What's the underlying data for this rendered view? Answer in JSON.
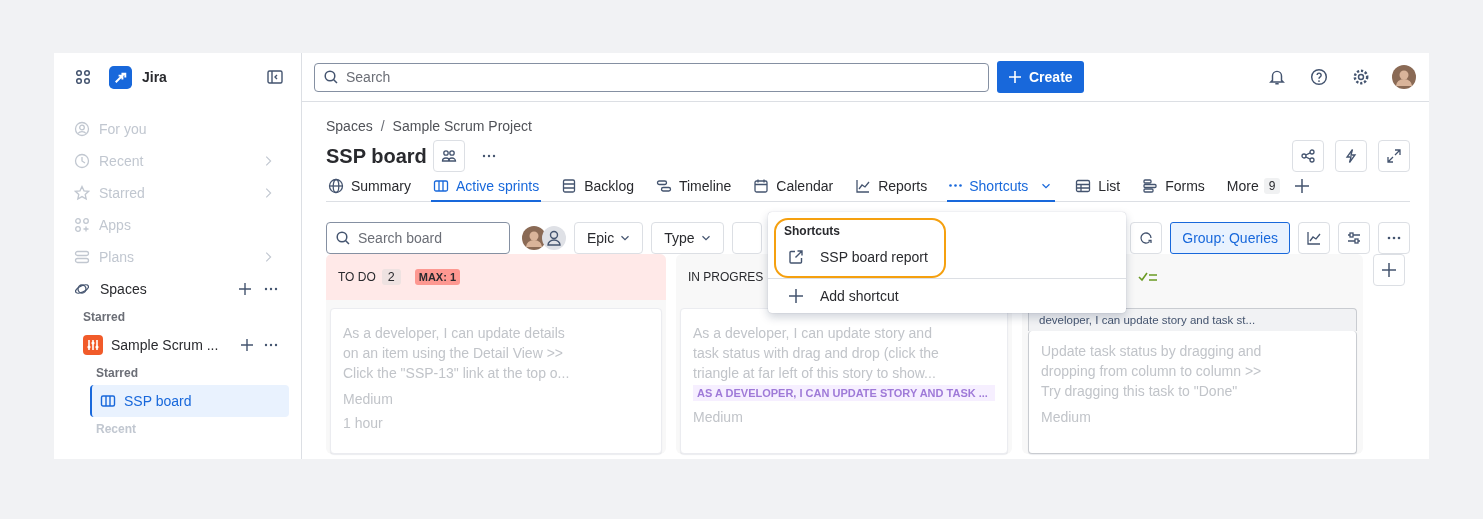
{
  "app": {
    "name": "Jira"
  },
  "sidebar": {
    "nav": [
      {
        "label": "For you",
        "disabled": true,
        "submenu": false
      },
      {
        "label": "Recent",
        "disabled": true,
        "submenu": true
      },
      {
        "label": "Starred",
        "disabled": true,
        "submenu": true
      },
      {
        "label": "Apps",
        "disabled": true,
        "submenu": false
      },
      {
        "label": "Plans",
        "disabled": true,
        "submenu": true
      }
    ],
    "spaces_label": "Spaces",
    "starred_heading": "Starred",
    "project": {
      "name": "Sample Scrum ...",
      "sub_heading": "Starred",
      "items": [
        {
          "label": "SSP board",
          "selected": true
        }
      ],
      "recent_heading": "Recent"
    }
  },
  "search": {
    "placeholder": "Search"
  },
  "create_button": "Create",
  "breadcrumbs": [
    "Spaces",
    "Sample Scrum Project"
  ],
  "breadcrumb_separator": "/",
  "title": "SSP board",
  "tabs": [
    {
      "label": "Summary",
      "selected": false
    },
    {
      "label": "Active sprints",
      "selected": true
    },
    {
      "label": "Backlog",
      "selected": false
    },
    {
      "label": "Timeline",
      "selected": false
    },
    {
      "label": "Calendar",
      "selected": false
    },
    {
      "label": "Reports",
      "selected": false
    },
    {
      "label": "Shortcuts",
      "selected": true,
      "kind": "dropdown"
    },
    {
      "label": "List",
      "selected": false
    },
    {
      "label": "Forms",
      "selected": false
    },
    {
      "label": "More",
      "selected": false,
      "kind": "more",
      "count": "9"
    }
  ],
  "toolbar": {
    "search_placeholder": "Search board",
    "filters": [
      "Epic",
      "Type"
    ],
    "group_button": {
      "label": "Group: Queries",
      "selected": true
    }
  },
  "columns": [
    {
      "title": "TO DO",
      "count": "2",
      "limit": "MAX: 1",
      "over_limit": true,
      "cards": [
        {
          "text": "As a developer, I can update details\non an item using the Detail View >>\nClick the \"SSP-13\" link at the top o...",
          "priority": "Medium",
          "estimate": "1 hour"
        }
      ]
    },
    {
      "title": "IN PROGRES",
      "over_limit": false,
      "cards": [
        {
          "text": "As a developer, I can update story and\ntask status with drag and drop (click the\ntriangle at far left of this story to show...",
          "tag": "AS A DEVELOPER, I CAN UPDATE STORY AND TASK ...",
          "priority": "Medium"
        }
      ]
    },
    {
      "kind": "done",
      "over_limit": false,
      "parent": "developer, I can update story and task st...",
      "cards": [
        {
          "text": "Update task status by dragging and\ndropping from column to column >>\nTry dragging this task to \"Done\"",
          "priority": "Medium"
        }
      ]
    }
  ],
  "menu": {
    "open": true,
    "highlighted": true,
    "heading": "Shortcuts",
    "items": [
      "SSP board report"
    ],
    "add_label": "Add shortcut"
  }
}
